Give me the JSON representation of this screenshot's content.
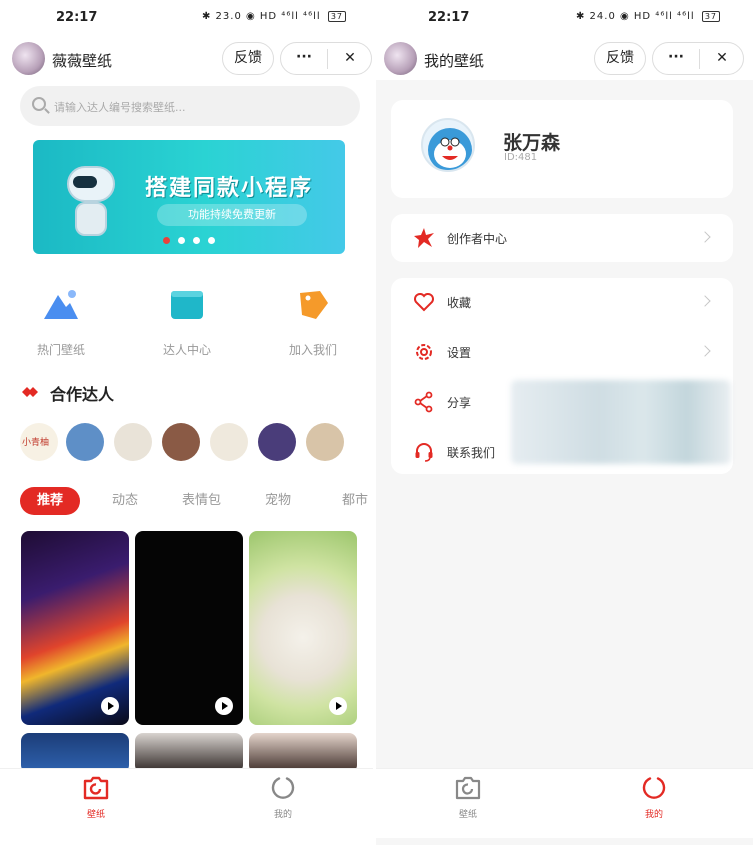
{
  "left": {
    "status": {
      "time": "22:17",
      "icons": "✱ 23.0 ◉ HD ⁴⁶ll ⁴⁶ll",
      "battery": "37"
    },
    "header": {
      "title": "薇薇壁纸",
      "feedback": "反馈",
      "more": "···",
      "close": "✕"
    },
    "search": {
      "placeholder": "请输入达人编号搜索壁纸..."
    },
    "banner": {
      "title": "搭建同款小程序",
      "subtitle": "功能持续免费更新",
      "dots": 4,
      "active_dot": 0
    },
    "quick_actions": [
      {
        "label": "热门壁纸",
        "icon": "mountain-icon",
        "color": "#4a8ef0"
      },
      {
        "label": "达人中心",
        "icon": "box-icon",
        "color": "#1fb7c9"
      },
      {
        "label": "加入我们",
        "icon": "tag-icon",
        "color": "#f59a2a"
      }
    ],
    "section": {
      "title": "合作达人"
    },
    "talents": [
      {
        "name": "talent-1",
        "caption": "小青柚",
        "color": "#f7f1e4"
      },
      {
        "name": "talent-2",
        "color": "#5e8fc7"
      },
      {
        "name": "talent-3",
        "color": "#e9e3d8"
      },
      {
        "name": "talent-4",
        "color": "#8a5a45"
      },
      {
        "name": "talent-5",
        "color": "#efe9dd"
      },
      {
        "name": "talent-6",
        "color": "#4a3d7a"
      },
      {
        "name": "talent-7",
        "color": "#d8c4a8"
      }
    ],
    "tabs": [
      "推荐",
      "动态",
      "表情包",
      "宠物",
      "都市"
    ],
    "cards": [
      {
        "name": "card-smoke",
        "bg": "linear-gradient(160deg,#1e0c33 0%,#3a1c6e 30%,#e0442c 55%,#f0b62c 65%,#102a7a 80%,#0a0a18 100%)",
        "play": true
      },
      {
        "name": "card-black",
        "bg": "#050505",
        "play": true
      },
      {
        "name": "card-dog",
        "bg": "radial-gradient(circle at 50% 55%,#f4f1ea 0%,#e8e2d6 35%,#cfe3a2 60%,#9cc66c 100%)",
        "play": true
      },
      {
        "name": "card-rain",
        "bg": "linear-gradient(180deg,#1c3d78,#2f63b0)",
        "play": false
      },
      {
        "name": "card-girl-1",
        "bg": "linear-gradient(180deg,#d9d4d0,#2b2321)",
        "play": false
      },
      {
        "name": "card-girl-2",
        "bg": "linear-gradient(180deg,#e5d5cc,#3b2a25)",
        "play": false
      }
    ],
    "tabbar": [
      {
        "label": "壁纸",
        "active": true
      },
      {
        "label": "我的",
        "active": false
      }
    ]
  },
  "right": {
    "status": {
      "time": "22:17",
      "icons": "✱ 24.0 ◉ HD ⁴⁶ll ⁴⁶ll",
      "battery": "37"
    },
    "header": {
      "title": "我的壁纸",
      "feedback": "反馈",
      "more": "···",
      "close": "✕"
    },
    "profile": {
      "name": "张万森",
      "id": "ID:481"
    },
    "creator": {
      "label": "创作者中心"
    },
    "menu": [
      {
        "label": "收藏",
        "icon": "heart-icon",
        "chevron": true
      },
      {
        "label": "设置",
        "icon": "gear-icon",
        "chevron": true
      },
      {
        "label": "分享",
        "icon": "share-icon",
        "chevron": false
      },
      {
        "label": "联系我们",
        "icon": "headset-icon",
        "chevron": false
      }
    ],
    "tabbar": [
      {
        "label": "壁纸",
        "active": false
      },
      {
        "label": "我的",
        "active": true
      }
    ]
  },
  "colors": {
    "accent": "#e32a24",
    "muted": "#999999"
  }
}
